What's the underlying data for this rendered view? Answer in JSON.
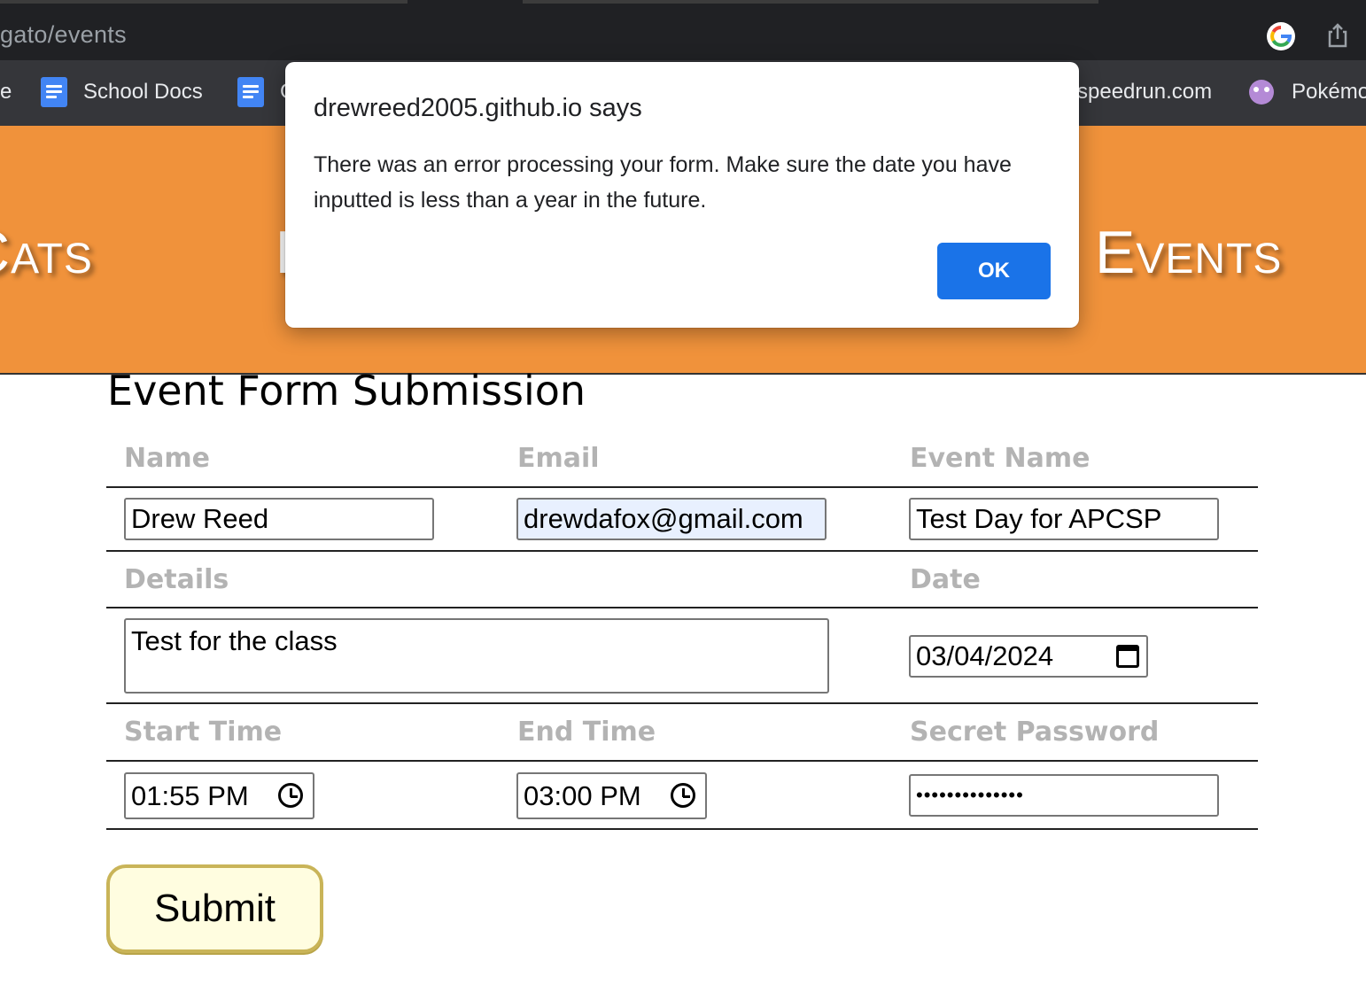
{
  "browser": {
    "url": "gato/events",
    "bookmarks": [
      {
        "label": "e",
        "icon": "none"
      },
      {
        "label": "School Docs",
        "icon": "google-docs-icon"
      },
      {
        "label": "G",
        "icon": "google-docs-icon"
      },
      {
        "label": "speedrun.com",
        "icon": "none"
      },
      {
        "label": "Pokémo",
        "icon": "pokemon-icon"
      }
    ]
  },
  "header": {
    "background": "#f0923b",
    "nav": [
      {
        "label": "Cats"
      },
      {
        "label": "I"
      },
      {
        "label": "Events"
      }
    ]
  },
  "form": {
    "title": "Event Form Submission",
    "labels": {
      "name": "Name",
      "email": "Email",
      "event_name": "Event Name",
      "details": "Details",
      "date": "Date",
      "start_time": "Start Time",
      "end_time": "End Time",
      "secret_password": "Secret Password"
    },
    "values": {
      "name": "Drew Reed",
      "email": "drewdafox@gmail.com",
      "event_name": "Test Day for APCSP",
      "details": "Test for the class",
      "date": "03/04/2024",
      "start_time": "01:55 PM",
      "end_time": "03:00 PM",
      "secret_password": "••••••••••••••"
    },
    "submit_label": "Submit"
  },
  "dialog": {
    "title": "drewreed2005.github.io says",
    "message": "There was an error processing your form. Make sure the date you have inputted is less than a year in the future.",
    "ok_label": "OK",
    "accent": "#1a73e8"
  }
}
